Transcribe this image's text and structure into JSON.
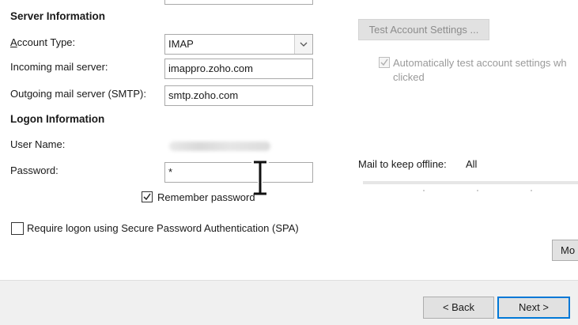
{
  "server_info": {
    "title": "Server Information",
    "account_type_label": "Account Type:",
    "account_type_value": "IMAP",
    "incoming_label": "Incoming mail server:",
    "incoming_value": "imappro.zoho.com",
    "outgoing_label": "Outgoing mail server (SMTP):",
    "outgoing_value": "smtp.zoho.com"
  },
  "logon_info": {
    "title": "Logon Information",
    "username_label": "User Name:",
    "password_label": "Password:",
    "password_value": "*",
    "remember_label": "Remember password",
    "remember_checked": true,
    "spa_label": "Require logon using Secure Password Authentication (SPA)",
    "spa_checked": false
  },
  "test_settings": {
    "button_label": "Test Account Settings ...",
    "auto_test_label_line1": "Automatically test account settings wh",
    "auto_test_label_line2": "clicked",
    "auto_test_checked": true
  },
  "offline": {
    "label": "Mail to keep offline:",
    "value": "All"
  },
  "buttons": {
    "more": "Mo",
    "back": "< Back",
    "next": "Next >"
  },
  "colors": {
    "accent": "#0078d7",
    "button_bg": "#e1e1e1",
    "footer_bg": "#f0f0f0"
  }
}
